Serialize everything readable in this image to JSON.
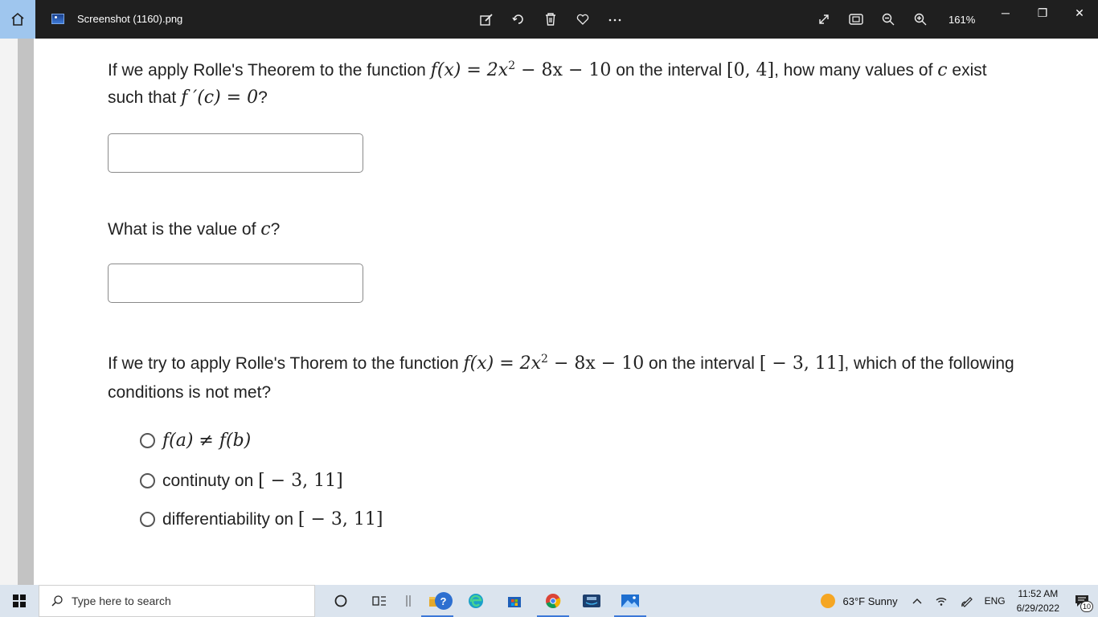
{
  "window": {
    "file_name": "Screenshot (1160).png",
    "zoom": "161%",
    "controls": {
      "minimize": "─",
      "restore": "❐",
      "close": "✕"
    }
  },
  "toolbar": {
    "tools": [
      "edit-icon",
      "rotate-icon",
      "delete-icon",
      "favorite-icon",
      "more-icon"
    ],
    "right_tools": [
      "fullscreen-icon",
      "fit-icon",
      "zoom-out-icon",
      "zoom-in-icon"
    ]
  },
  "question1": {
    "p1": "If we apply Rolle's Theorem to the function ",
    "math_f": "f(x) = 2x",
    "exp": "2",
    "math_rest": " − 8x − 10",
    "p2": " on the interval ",
    "interval": "[0, 4]",
    "p3": ", how many values of ",
    "c": "c",
    "p4": " exist such that ",
    "deriv": "f ′(c) = 0",
    "p5": "?"
  },
  "question2": {
    "p1": "What is the value of ",
    "c": "c",
    "p2": "?"
  },
  "question3": {
    "p1": "If we try to apply Rolle's Thorem to the function ",
    "math_f": "f(x) = 2x",
    "exp": "2",
    "math_rest": " − 8x − 10",
    "p2": " on the interval ",
    "interval": "[ − 3, 11]",
    "p3": ", which of the following conditions is not met?"
  },
  "options": [
    {
      "math": "f(a) ≠ f(b)",
      "text": ""
    },
    {
      "text": "continuty on ",
      "math": "[ − 3, 11]"
    },
    {
      "text": "differentiability on ",
      "math": "[ − 3, 11]"
    }
  ],
  "taskbar": {
    "search_placeholder": "Type here to search",
    "weather": "63°F  Sunny",
    "lang": "ENG",
    "time": "11:52 AM",
    "date": "6/29/2022",
    "notification_count": "10",
    "help_label": "?"
  },
  "colors": {
    "accent": "#3b78d8",
    "titlebar": "#1f1f1f",
    "home": "#9fc6ee",
    "sun": "#f5a623"
  }
}
